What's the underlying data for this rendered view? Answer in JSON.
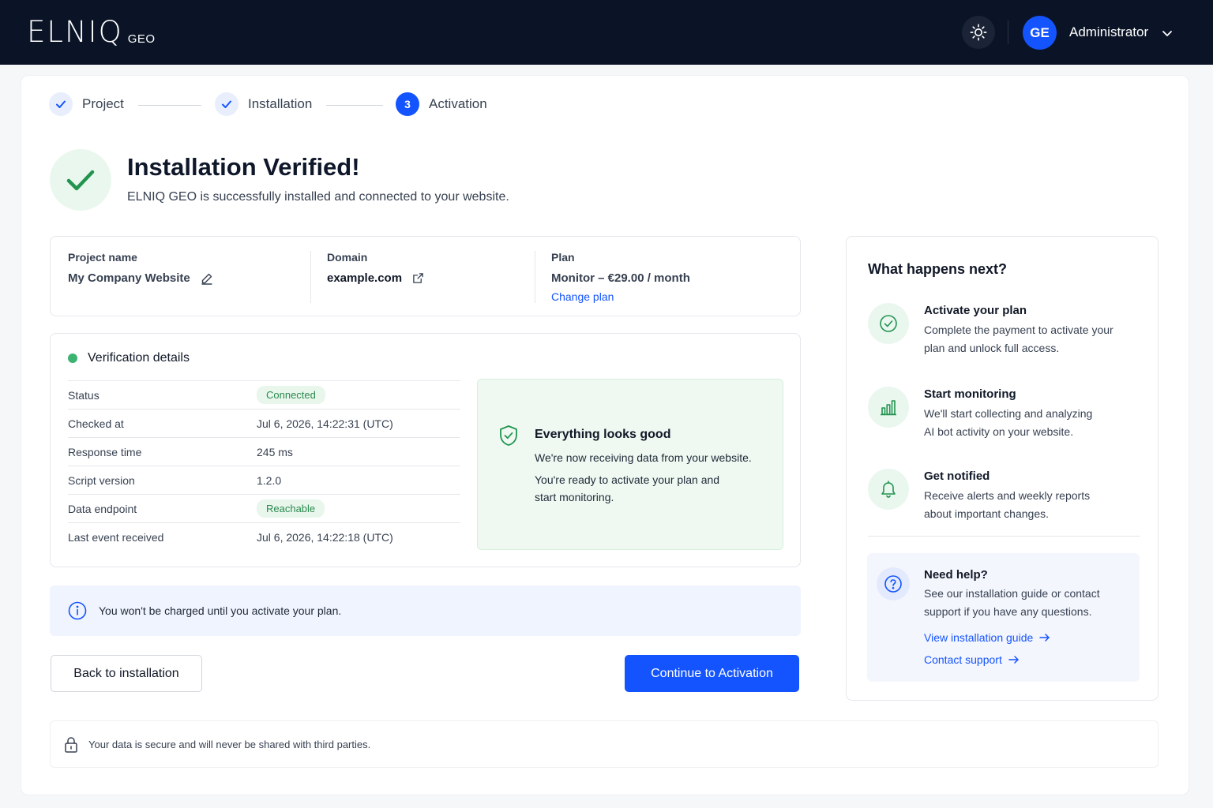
{
  "header": {
    "logo_mark": "ELNIQ",
    "logo_sub": "GEO",
    "avatar_initials": "GE",
    "user_name": "Administrator"
  },
  "stepper": {
    "steps": [
      {
        "label": "Project",
        "state": "done"
      },
      {
        "label": "Installation",
        "state": "done"
      },
      {
        "label": "Activation",
        "state": "active",
        "number": "3"
      }
    ]
  },
  "hero": {
    "title": "Installation Verified!",
    "subtitle": "ELNIQ GEO is successfully installed and connected to your website."
  },
  "project_info": {
    "project_name_label": "Project name",
    "project_name_value": "My Company Website",
    "domain_label": "Domain",
    "domain_value": "example.com",
    "plan_label": "Plan",
    "plan_value": "Monitor – €29.00 / month",
    "change_plan_link": "Change plan"
  },
  "verification": {
    "title": "Verification details",
    "rows": [
      {
        "key": "Status",
        "value": "Connected",
        "badge": true
      },
      {
        "key": "Checked at",
        "value": "Jul 6, 2026, 14:22:31 (UTC)",
        "badge": false
      },
      {
        "key": "Response time",
        "value": "245 ms",
        "badge": false
      },
      {
        "key": "Script version",
        "value": "1.2.0",
        "badge": false
      },
      {
        "key": "Data endpoint",
        "value": "Reachable",
        "badge": true
      },
      {
        "key": "Last event received",
        "value": "Jul 6, 2026, 14:22:18 (UTC)",
        "badge": false
      }
    ],
    "good_title": "Everything looks good",
    "good_line1": "We're now receiving data from your website.",
    "good_line2a": "You're ready to activate your plan and",
    "good_line2b": "start monitoring."
  },
  "notice": {
    "text": "You won't be charged until you activate your plan."
  },
  "actions": {
    "back_label": "Back to installation",
    "continue_label": "Continue to Activation"
  },
  "next_steps": {
    "title": "What happens next?",
    "items": [
      {
        "icon": "check-circle-icon",
        "title": "Activate your plan",
        "line1": "Complete the payment to activate your",
        "line2": "plan and unlock full access."
      },
      {
        "icon": "bar-chart-icon",
        "title": "Start monitoring",
        "line1": "We'll start collecting and analyzing",
        "line2": "AI bot activity on your website."
      },
      {
        "icon": "bell-icon",
        "title": "Get notified",
        "line1": "Receive alerts and weekly reports",
        "line2": "about important changes."
      }
    ],
    "help_title": "Need help?",
    "help_line1": "See our installation guide or contact",
    "help_line2": "support if you have any questions.",
    "guide_link": "View installation guide",
    "support_link": "Contact support"
  },
  "security": {
    "text": "Your data is secure and will never be shared with third parties."
  },
  "colors": {
    "header_bg": "#0b1427",
    "accent": "#1454ff",
    "success": "#2b9a5a",
    "success_bg": "#eaf7ef"
  }
}
